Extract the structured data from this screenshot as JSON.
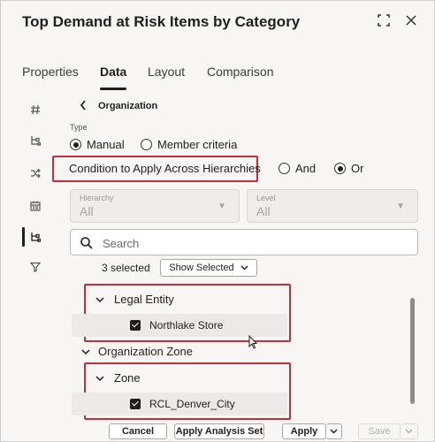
{
  "dialog": {
    "title": "Top Demand at Risk Items by Category"
  },
  "tabs": [
    {
      "label": "Properties"
    },
    {
      "label": "Data"
    },
    {
      "label": "Layout"
    },
    {
      "label": "Comparison"
    }
  ],
  "active_tab": "Data",
  "breadcrumb": {
    "label": "Organization"
  },
  "type": {
    "label": "Type",
    "options": [
      {
        "label": "Manual",
        "checked": true
      },
      {
        "label": "Member criteria",
        "checked": false
      }
    ]
  },
  "condition": {
    "label": "Condition to Apply Across Hierarchies",
    "options": [
      {
        "label": "And",
        "checked": false
      },
      {
        "label": "Or",
        "checked": true
      }
    ]
  },
  "hierarchy": {
    "label": "Hierarchy",
    "value": "All"
  },
  "level": {
    "label": "Level",
    "value": "All"
  },
  "search": {
    "placeholder": "Search",
    "value": ""
  },
  "selection": {
    "count_text": "3 selected",
    "show_selected_label": "Show Selected"
  },
  "tree": {
    "legal_entity": {
      "label": "Legal Entity",
      "child": {
        "label": "Northlake Store",
        "checked": true
      }
    },
    "organization_zone": {
      "label": "Organization Zone"
    },
    "zone": {
      "label": "Zone",
      "child": {
        "label": "RCL_Denver_City",
        "checked": true
      }
    }
  },
  "footer": {
    "cancel_label": "Cancel",
    "apply_analysis_set_label": "Apply Analysis Set",
    "apply_label": "Apply",
    "save_label": "Save"
  },
  "colors": {
    "highlight_red": "#c62d36",
    "background": "#f7f6f5"
  }
}
